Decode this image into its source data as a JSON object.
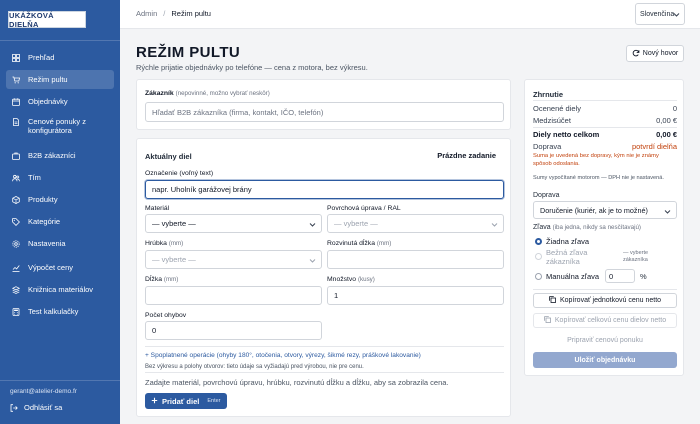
{
  "sidebar": {
    "logo": "UKÁŽKOVÁ DIELŇA",
    "items": [
      {
        "label": "Prehľad",
        "icon": "grid-icon"
      },
      {
        "label": "Režim pultu",
        "icon": "cart-icon",
        "active": true
      },
      {
        "label": "Objednávky",
        "icon": "calendar-icon"
      },
      {
        "label": "Cenové ponuky z konfigurátora",
        "icon": "document-icon"
      },
      {
        "label": "B2B zákazníci",
        "icon": "users-icon"
      },
      {
        "label": "Tím",
        "icon": "team-icon"
      },
      {
        "label": "Produkty",
        "icon": "box-icon"
      },
      {
        "label": "Kategórie",
        "icon": "tag-icon"
      },
      {
        "label": "Nastavenia",
        "icon": "gear-icon"
      },
      {
        "label": "Výpočet ceny",
        "icon": "chart-icon"
      },
      {
        "label": "Knižnica materiálov",
        "icon": "layers-icon"
      },
      {
        "label": "Test kalkulačky",
        "icon": "calculator-icon"
      }
    ],
    "user_email": "gerant@atelier-demo.fr",
    "logout_label": "Odhlásiť sa"
  },
  "topbar": {
    "breadcrumb_root": "Admin",
    "breadcrumb_sep": "/",
    "breadcrumb_current": "Režim pultu",
    "language": "Slovenčina"
  },
  "header": {
    "title": "REŽIM PULTU",
    "subtitle": "Rýchle prijatie objednávky po telefóne — cena z motora, bez výkresu.",
    "new_button": "Nový hovor"
  },
  "customer": {
    "label": "Zákazník",
    "label_note": "(nepovinné, možno vybrať neskôr)",
    "placeholder": "Hľadať B2B zákazníka (firma, kontakt, IČO, telefón)"
  },
  "part": {
    "title": "Aktuálny diel",
    "clear_link": "Prázdne zadanie",
    "designation_label": "Označenie (voľný text)",
    "designation_value": "napr. Uholník garážovej brány",
    "material_label": "Materiál",
    "material_value": "— vyberte —",
    "finish_label": "Povrchová úprava / RAL",
    "finish_value": "— vyberte —",
    "thickness_label": "Hrúbka",
    "thickness_unit": "(mm)",
    "thickness_value": "— vyberte —",
    "developed_label": "Rozvinutá dĺžka",
    "developed_unit": "(mm)",
    "developed_value": "",
    "length_label": "Dĺžka",
    "length_unit": "(mm)",
    "length_value": "",
    "quantity_label": "Množstvo",
    "quantity_unit": "(kusy)",
    "quantity_value": "1",
    "bends_label": "Počet ohybov",
    "bends_value": "0",
    "ops_link": "+ Spoplatnené operácie (ohyby 180°, otočenia, otvory, výrezy, šikmé rezy, práškové lakovanie)",
    "ops_note": "Bez výkresu a polohy otvorov: tieto údaje sa vyžiadajú pred výrobou, nie pre cenu.",
    "hint": "Zadajte materiál, povrchovú úpravu, hrúbku, rozvinutú dĺžku a dĺžku, aby sa zobrazila cena.",
    "add_button": "Pridať diel",
    "add_kbd": "Enter"
  },
  "summary": {
    "title": "Zhrnutie",
    "rows": [
      {
        "label": "Ocenené diely",
        "value": "0"
      },
      {
        "label": "Medzisúčet",
        "value": "0,00 €"
      }
    ],
    "net_label": "Diely netto celkom",
    "net_value": "0,00 €",
    "shipping_label": "Doprava",
    "shipping_value": "potvrdí dielňa",
    "shipping_warning": "Suma je uvedená bez dopravy, kým nie je známy spôsob odoslania.",
    "engine_note": "Sumy vypočítané motorom — DPH nie je nastavená.",
    "delivery_label": "Doprava",
    "delivery_value": "Doručenie (kuriér, ak je to možné)",
    "discount_label": "Zľava",
    "discount_note": "(iba jedna, nikdy sa nesčítavajú)",
    "discount_none": "Žiadna zľava",
    "discount_standard": "Bežná zľava zákazníka",
    "discount_standard_note": "— vyberte zákazníka",
    "discount_manual": "Manuálna zľava",
    "discount_manual_value": "0",
    "discount_unit": "%",
    "copy_unit_button": "Kopírovať jednotkovú cenu netto",
    "copy_total_button": "Kopírovať celkovú cenu dielov netto",
    "prepare_button": "Pripraviť cenovú ponuku",
    "save_button": "Uložiť objednávku"
  }
}
